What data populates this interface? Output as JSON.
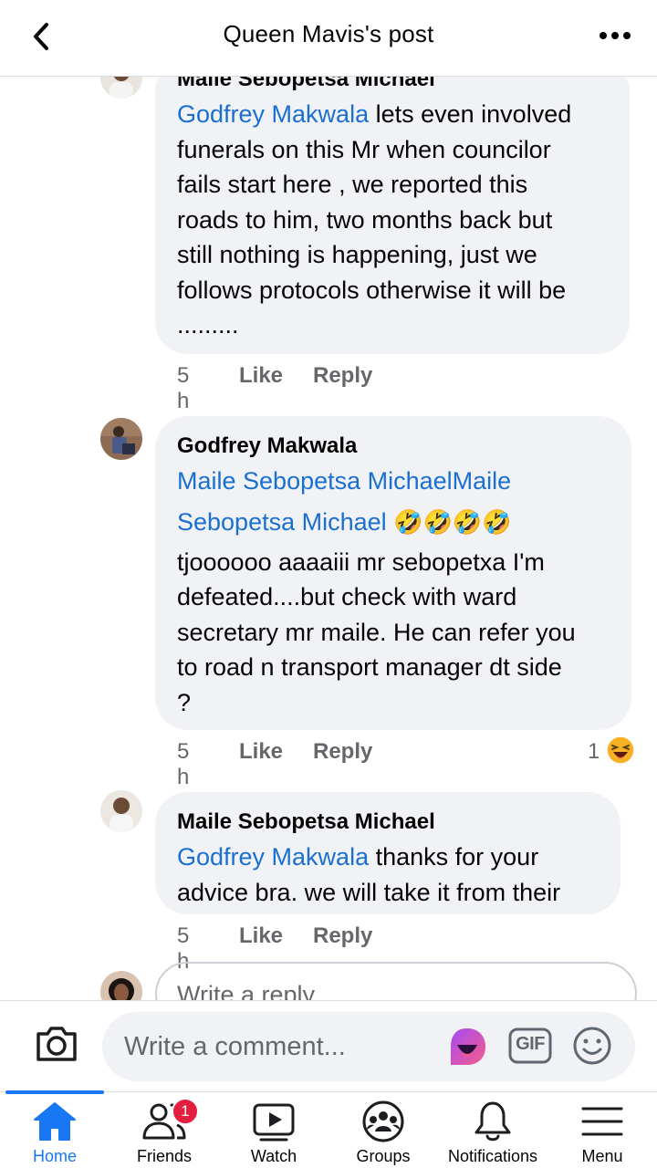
{
  "header": {
    "title": "Queen Mavis's post",
    "back_icon": "chevron-left-icon",
    "more_icon": "more-horizontal-icon"
  },
  "comments": [
    {
      "author": "Maile Sebopetsa Michael",
      "mention": "Godfrey Makwala",
      "lines": [
        " lets even involved",
        "funerals on this Mr when councilor",
        "fails start here , we reported this",
        "roads to him, two months back but",
        "still nothing is happening, just we",
        "follows protocols otherwise it will be",
        "........."
      ],
      "time": "5 h",
      "like_label": "Like",
      "reply_label": "Reply"
    },
    {
      "author": "Godfrey Makwala",
      "mention_line1": "Maile Sebopetsa MichaelMaile",
      "mention_line2": "Sebopetsa Michael",
      "emojis": "🤣🤣🤣🤣",
      "lines": [
        "tjoooooo aaaaiii mr sebopetxa I'm",
        "defeated....but check with ward",
        "secretary mr maile. He can refer you",
        "to road n transport  manager dt side",
        "?"
      ],
      "time": "5 h",
      "like_label": "Like",
      "reply_label": "Reply",
      "reaction_count": "1",
      "reaction_icon": "laughing-emoji-icon"
    },
    {
      "author": "Maile Sebopetsa Michael",
      "mention": "Godfrey Makwala",
      "lines": [
        " thanks for your",
        "advice bra. we will take it from their"
      ],
      "time": "5 h",
      "like_label": "Like",
      "reply_label": "Reply"
    }
  ],
  "reply_box": {
    "placeholder": "Write a reply..."
  },
  "composer": {
    "placeholder": "Write a comment...",
    "camera_icon": "camera-icon",
    "avatar_icon": "avatar-sticker-icon",
    "gif_label": "GIF",
    "emoji_icon": "smiley-icon"
  },
  "nav": {
    "items": [
      {
        "label": "Home",
        "icon": "home-icon",
        "active": true
      },
      {
        "label": "Friends",
        "icon": "friends-icon",
        "badge": "1"
      },
      {
        "label": "Watch",
        "icon": "watch-icon"
      },
      {
        "label": "Groups",
        "icon": "groups-icon"
      },
      {
        "label": "Notifications",
        "icon": "bell-icon"
      },
      {
        "label": "Menu",
        "icon": "hamburger-icon"
      }
    ]
  },
  "colors": {
    "accent": "#1877f2",
    "mention": "#1a6fd1",
    "bubble": "#f0f2f5",
    "muted": "#65676b",
    "badge": "#e41e3f"
  }
}
